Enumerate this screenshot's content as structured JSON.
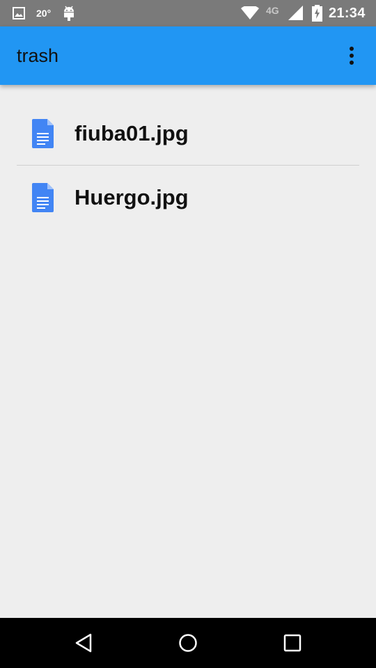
{
  "status_bar": {
    "temperature": "20°",
    "network": "4G",
    "time": "21:34"
  },
  "app_bar": {
    "title": "trash"
  },
  "files": [
    {
      "name": "fiuba01.jpg",
      "icon": "document-icon"
    },
    {
      "name": "Huergo.jpg",
      "icon": "document-icon"
    }
  ],
  "colors": {
    "app_bar": "#2196f3",
    "status_bar": "#7a7a7a",
    "background": "#eeeeee",
    "file_icon": "#4285f4",
    "nav_bar": "#000000"
  },
  "nav": {
    "back": "back-icon",
    "home": "home-icon",
    "recents": "recents-icon"
  }
}
